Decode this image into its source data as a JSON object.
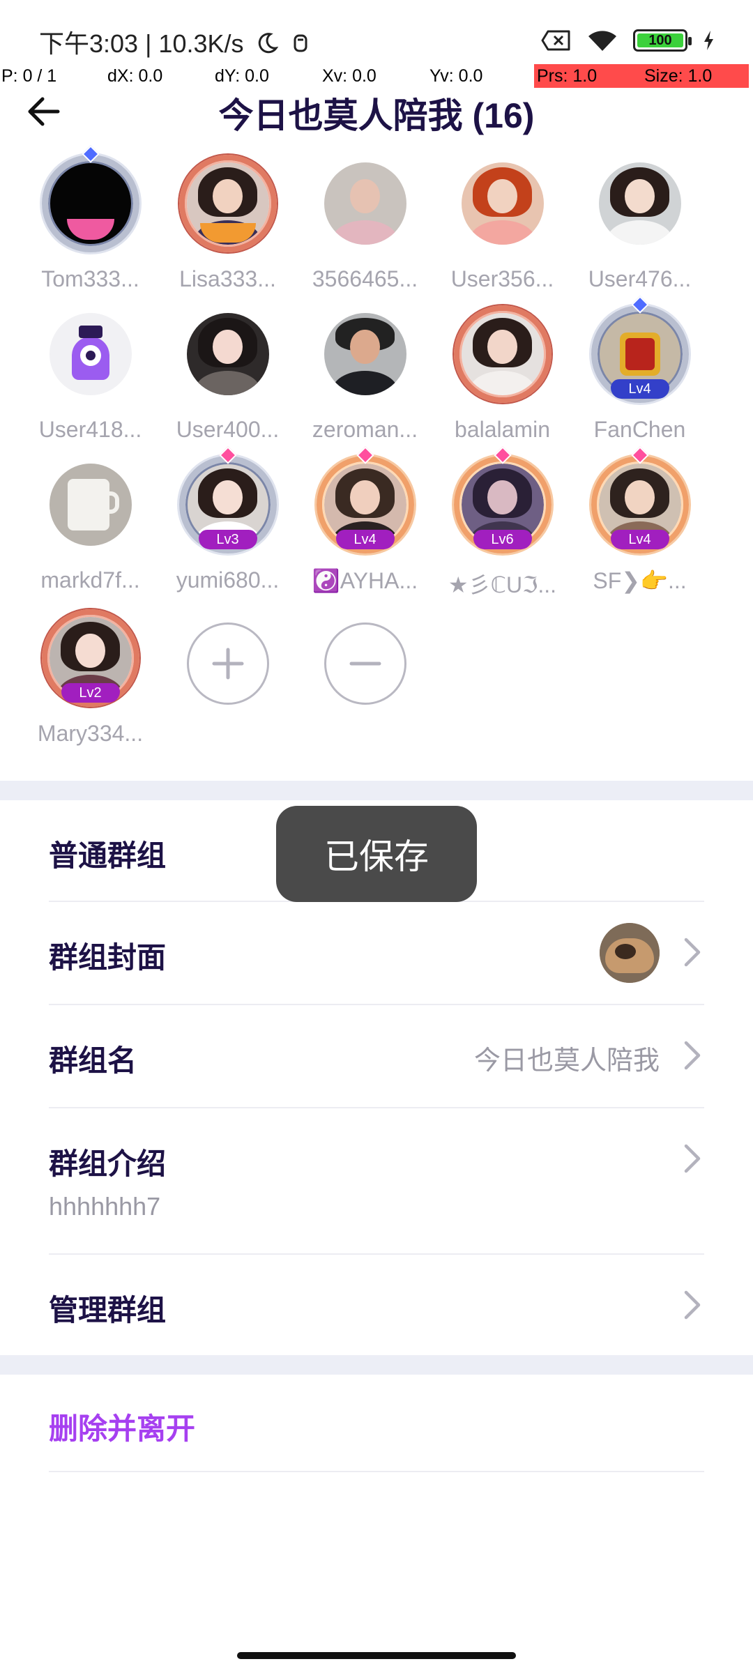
{
  "status_bar": {
    "time_speed": "下午3:03 | 10.3K/s",
    "battery": "100",
    "icons": [
      "moon-icon",
      "notification-icon",
      "sim-off-icon",
      "wifi-icon",
      "battery-icon",
      "charging-icon"
    ]
  },
  "debug": {
    "p": "P: 0 / 1",
    "dx": "dX: 0.0",
    "dy": "dY: 0.0",
    "xv": "Xv: 0.0",
    "yv": "Yv: 0.0",
    "prs": "Prs: 1.0",
    "size": "Size: 1.0"
  },
  "header": {
    "title": "今日也莫人陪我 (16)"
  },
  "members": [
    {
      "name": "Tom333..."
    },
    {
      "name": "Lisa333..."
    },
    {
      "name": "3566465..."
    },
    {
      "name": "User356..."
    },
    {
      "name": "User476..."
    },
    {
      "name": "User418..."
    },
    {
      "name": "User400..."
    },
    {
      "name": "zeroman..."
    },
    {
      "name": "balalamin"
    },
    {
      "name": "FanChen",
      "level": "Lv4"
    },
    {
      "name": "markd7f..."
    },
    {
      "name": "yumi680...",
      "level": "Lv3"
    },
    {
      "name": "☯️AYHA...",
      "level": "Lv4"
    },
    {
      "name": "★彡ℂUℑ...",
      "level": "Lv6"
    },
    {
      "name": "SF❯👉...",
      "level": "Lv4"
    },
    {
      "name": "Mary334...",
      "level": "Lv2"
    }
  ],
  "settings": {
    "group_type": "普通群组",
    "cover_label": "群组封面",
    "name_label": "群组名",
    "name_value": "今日也莫人陪我",
    "intro_label": "群组介绍",
    "intro_value": "hhhhhhh7",
    "manage_label": "管理群组",
    "delete_label": "删除并离开"
  },
  "toast": {
    "text": "已保存"
  },
  "colors": {
    "title": "#1d1246",
    "accent": "#a640f0",
    "muted": "#9a99a4",
    "band": "#eceef6"
  }
}
